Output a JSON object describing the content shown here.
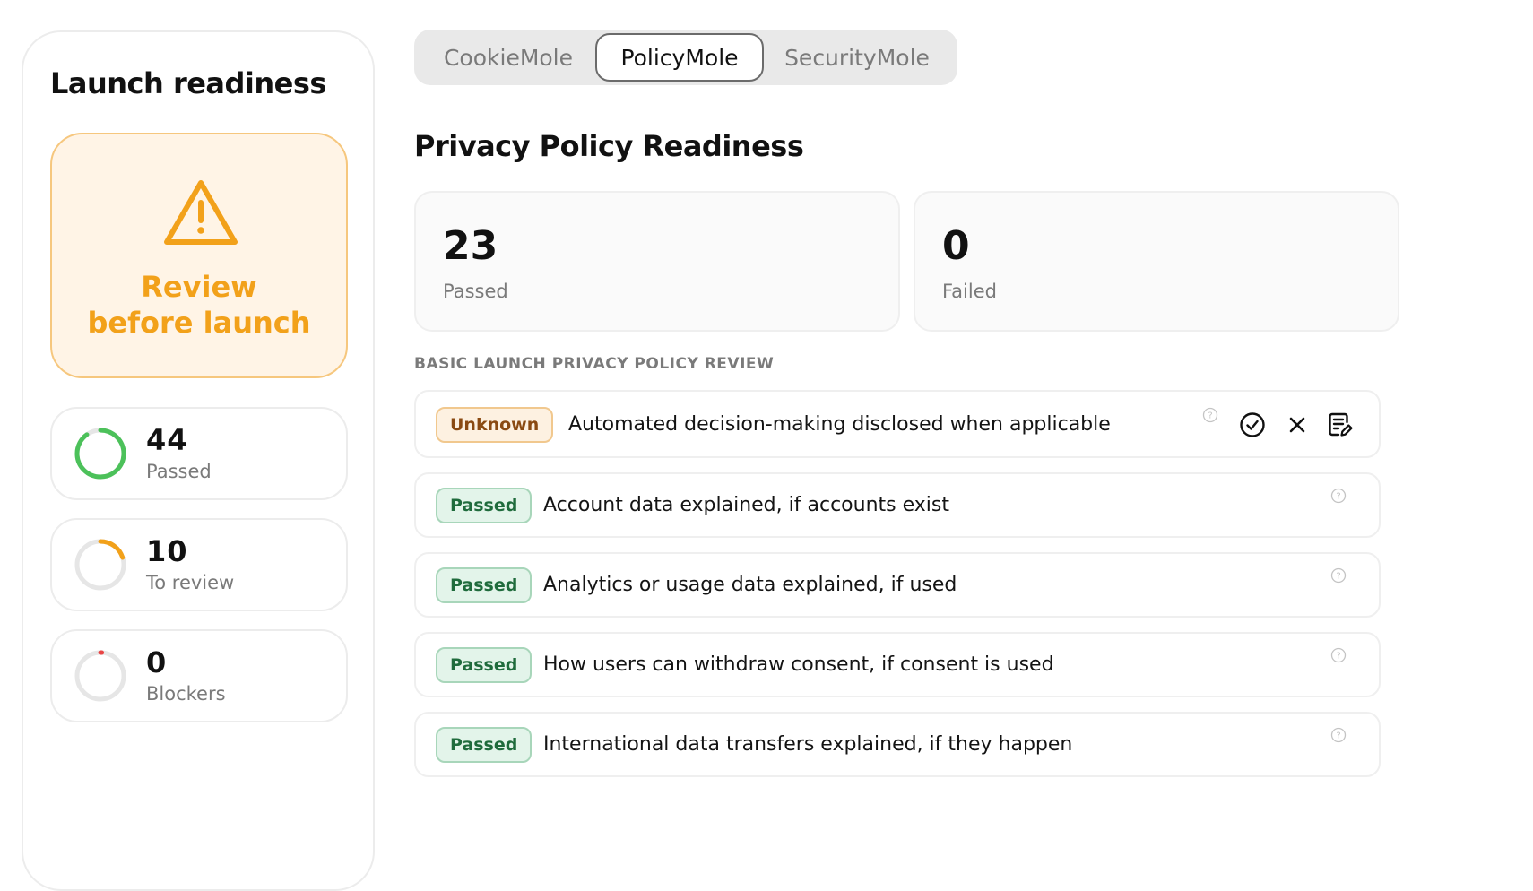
{
  "sidebar": {
    "title": "Launch readiness",
    "status": {
      "line1": "Review",
      "line2": "before launch",
      "icon": "warning-triangle-icon",
      "color": "#f2a11a"
    },
    "stats": [
      {
        "value": "44",
        "label": "Passed",
        "progress": 0.9,
        "color": "#4cc15a"
      },
      {
        "value": "10",
        "label": "To review",
        "progress": 0.2,
        "color": "#f2a11a"
      },
      {
        "value": "0",
        "label": "Blockers",
        "progress": 0.01,
        "color": "#e84545"
      }
    ]
  },
  "tabs": [
    {
      "label": "CookieMole",
      "active": false
    },
    {
      "label": "PolicyMole",
      "active": true
    },
    {
      "label": "SecurityMole",
      "active": false
    }
  ],
  "main": {
    "title": "Privacy Policy Readiness",
    "summary": [
      {
        "value": "23",
        "label": "Passed"
      },
      {
        "value": "0",
        "label": "Failed"
      }
    ],
    "section_heading": "BASIC LAUNCH PRIVACY POLICY REVIEW",
    "checks": [
      {
        "status": "Unknown",
        "text": "Automated decision-making disclosed when applicable"
      },
      {
        "status": "Passed",
        "text": "Account data explained, if accounts exist"
      },
      {
        "status": "Passed",
        "text": "Analytics or usage data explained, if used"
      },
      {
        "status": "Passed",
        "text": "How users can withdraw consent, if consent is used"
      },
      {
        "status": "Passed",
        "text": "International data transfers explained, if they happen"
      }
    ],
    "row_actions": [
      "check-circle-icon",
      "close-icon",
      "note-edit-icon"
    ]
  }
}
